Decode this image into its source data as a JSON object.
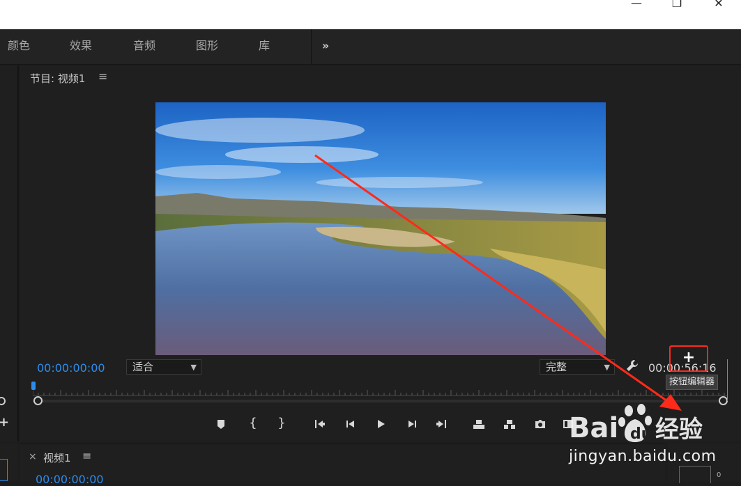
{
  "window_controls": {
    "minimize": "—",
    "maximize": "❐",
    "close": "✕"
  },
  "workspace_tabs": [
    {
      "label": "颜色"
    },
    {
      "label": "效果"
    },
    {
      "label": "音频"
    },
    {
      "label": "图形"
    },
    {
      "label": "库"
    }
  ],
  "more_tabs_label": "»",
  "program_monitor": {
    "title": "节目: 视频1",
    "menu_icon": "≡",
    "current_timecode": "00:00:00:00",
    "zoom_select": "适合",
    "quality_select": "完整",
    "duration_timecode": "00:00:56:16",
    "settings_icon": "wrench-icon"
  },
  "transport_controls": [
    {
      "name": "add-marker",
      "icon": "marker-icon"
    },
    {
      "name": "mark-in",
      "icon": "mark-in-icon",
      "glyph": "{"
    },
    {
      "name": "mark-out",
      "icon": "mark-out-icon",
      "glyph": "}"
    },
    {
      "name": "go-to-in",
      "icon": "go-to-in-icon"
    },
    {
      "name": "step-back",
      "icon": "step-back-icon"
    },
    {
      "name": "play",
      "icon": "play-icon"
    },
    {
      "name": "step-forward",
      "icon": "step-forward-icon"
    },
    {
      "name": "go-to-out",
      "icon": "go-to-out-icon"
    },
    {
      "name": "lift",
      "icon": "lift-icon"
    },
    {
      "name": "extract",
      "icon": "extract-icon"
    },
    {
      "name": "export-frame",
      "icon": "camera-icon"
    },
    {
      "name": "comparison-view",
      "icon": "comparison-icon"
    }
  ],
  "button_editor": {
    "label": "+",
    "tooltip": "按钮编辑器",
    "highlight_color": "#ff2a1a"
  },
  "timeline_panel": {
    "close_glyph": "×",
    "title": "视频1",
    "menu_icon": "≡",
    "timecode": "00:00:00:00"
  },
  "right_mini_value": "0",
  "watermark": {
    "brand": "Bai du 经验",
    "url": "jingyan.baidu.com"
  },
  "colors": {
    "timecode_blue": "#2d8ceb",
    "panel_bg": "#1f1f1f",
    "annotation_red": "#ff2a1a"
  }
}
